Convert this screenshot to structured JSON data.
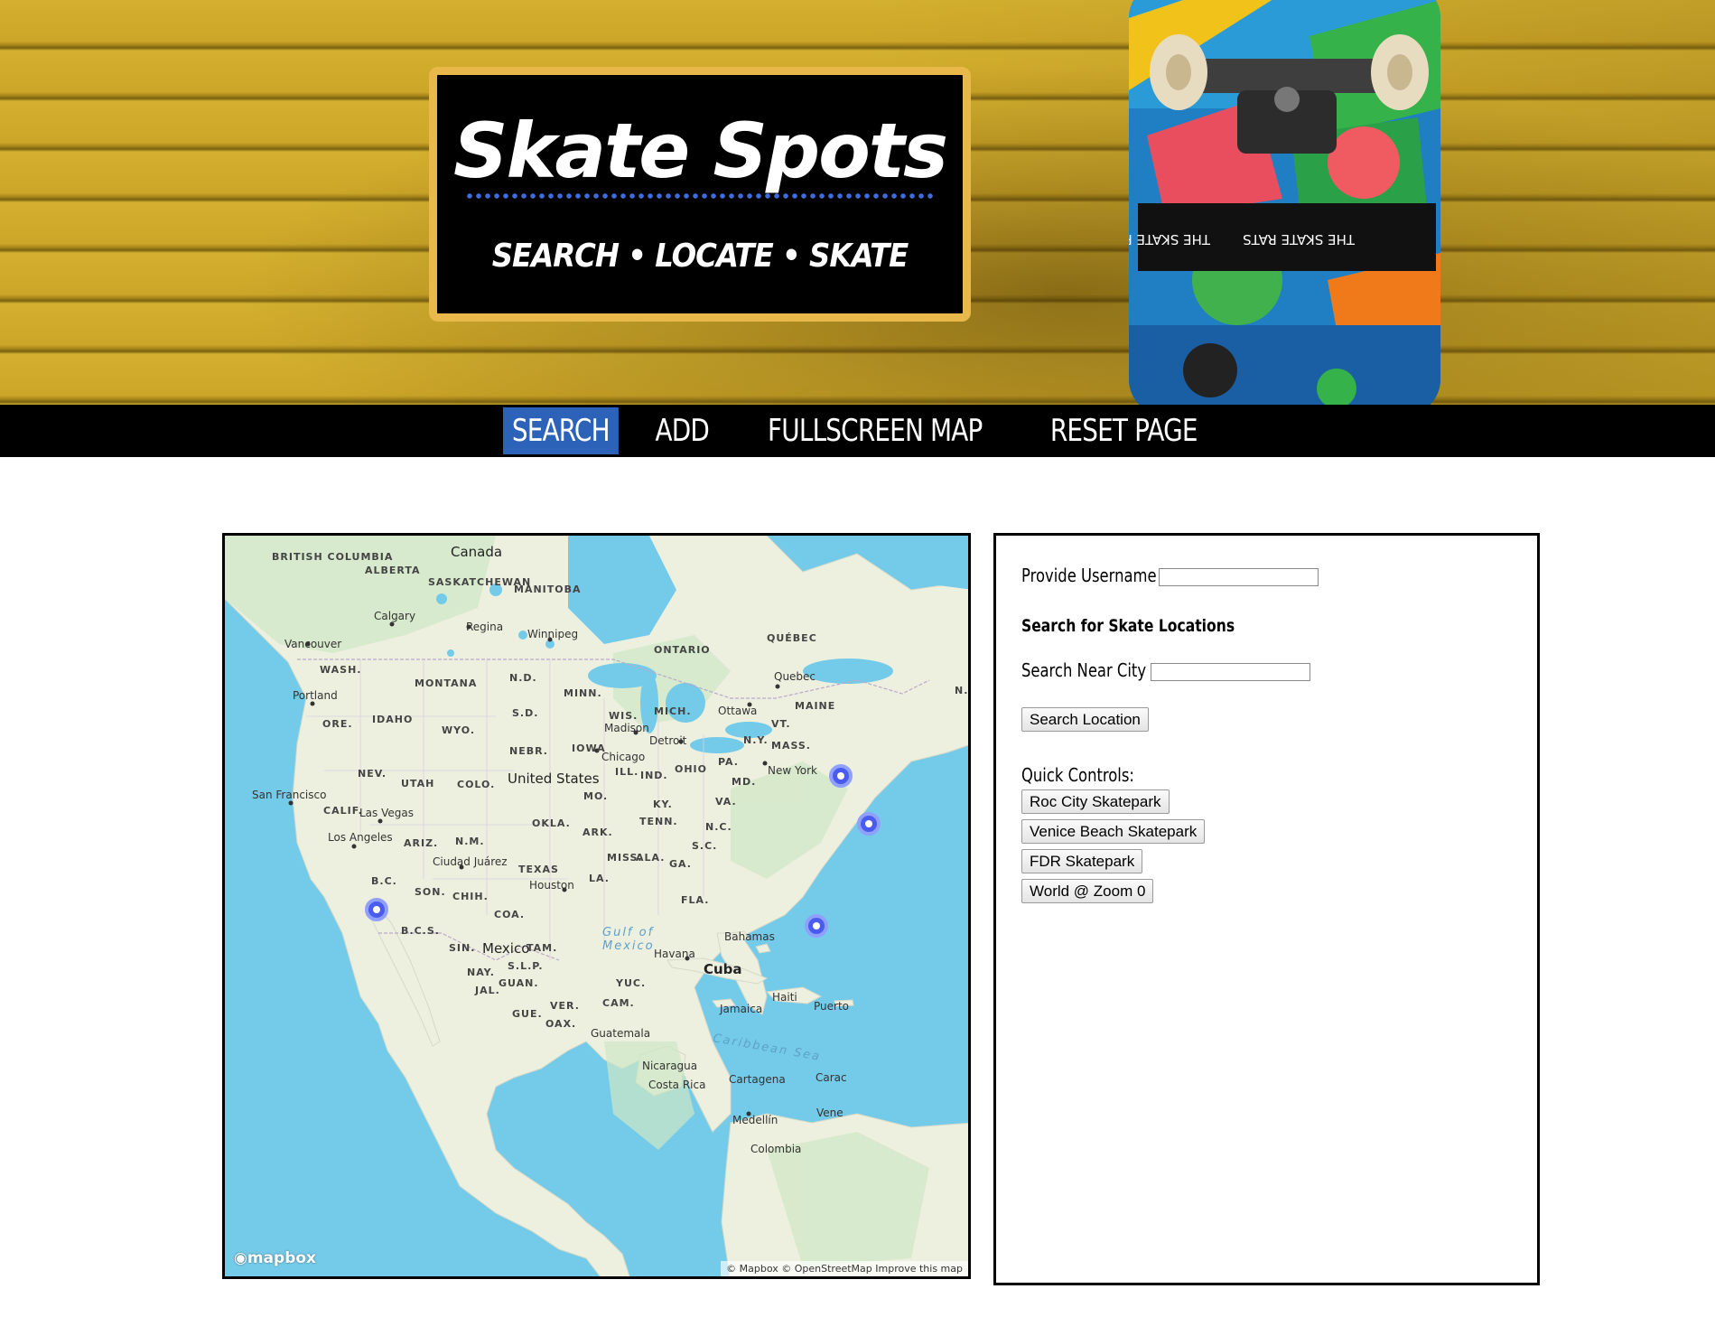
{
  "header": {
    "title": "Skate Spots",
    "tagline": "SEARCH • LOCATE • SKATE",
    "deck_brand": "THE SKATE RATS"
  },
  "nav": {
    "items": [
      {
        "label": "SEARCH",
        "active": true
      },
      {
        "label": "ADD",
        "active": false
      },
      {
        "label": "FULLSCREEN MAP",
        "active": false
      },
      {
        "label": "RESET PAGE",
        "active": false
      }
    ]
  },
  "map": {
    "countries": {
      "canada": "Canada",
      "us": "United States",
      "mexico": "Mexico",
      "cuba": "Cuba"
    },
    "provinces": {
      "bc": "BRITISH COLUMBIA",
      "ab": "ALBERTA",
      "sk": "SASKATCHEWAN",
      "mb": "MANITOBA",
      "on": "ONTARIO",
      "qc": "QUÉBEC"
    },
    "states": {
      "wa": "WASH.",
      "or": "ORE.",
      "id": "IDAHO",
      "mt": "MONTANA",
      "wy": "WYO.",
      "nd": "N.D.",
      "sd": "S.D.",
      "nebr": "NEBR.",
      "minn": "MINN.",
      "wis": "WIS.",
      "mich": "MICH.",
      "iowa": "IOWA",
      "ill": "ILL.",
      "ind": "IND.",
      "ohio": "OHIO",
      "pa": "PA.",
      "ny": "N.Y.",
      "mass": "MASS.",
      "vt": "VT.",
      "maine": "MAINE",
      "nev": "NEV.",
      "utah": "UTAH",
      "colo": "COLO.",
      "calif": "CALIF.",
      "ariz": "ARIZ.",
      "nm": "N.M.",
      "texas": "TEXAS",
      "okla": "OKLA.",
      "ark": "ARK.",
      "mo": "MO.",
      "ky": "KY.",
      "tenn": "TENN.",
      "va": "VA.",
      "md": "MD.",
      "nc": "N.C.",
      "sc": "S.C.",
      "miss": "MISS.",
      "ala": "ALA.",
      "ga": "GA.",
      "la": "LA.",
      "fla": "FLA.",
      "nb": "N.B"
    },
    "mx_states": {
      "bc": "B.C.",
      "son": "SON.",
      "chih": "CHIH.",
      "coa": "COA.",
      "bcs": "B.C.S.",
      "sin": "SIN.",
      "tam": "TAM.",
      "nay": "NAY.",
      "slp": "S.L.P.",
      "jal": "JAL.",
      "guan": "GUAN.",
      "gue": "GUE.",
      "oax": "OAX.",
      "ver": "VER.",
      "cam": "CAM.",
      "yuc": "YUC."
    },
    "cities": {
      "vancouver": "Vancouver",
      "calgary": "Calgary",
      "regina": "Regina",
      "winnipeg": "Winnipeg",
      "portland": "Portland",
      "quebec": "Quebec",
      "ottawa": "Ottawa",
      "madison": "Madison",
      "detroit": "Detroit",
      "chicago": "Chicago",
      "new_york": "New York",
      "san_francisco": "San Francisco",
      "las_vegas": "Las Vegas",
      "los_angeles": "Los Angeles",
      "ciudad_juarez": "Ciudad Juárez",
      "houston": "Houston",
      "havana": "Havana",
      "bahamas": "Bahamas",
      "jamaica": "Jamaica",
      "haiti": "Haiti",
      "puerto": "Puerto",
      "guatemala": "Guatemala",
      "nicaragua": "Nicaragua",
      "costa_rica": "Costa Rica",
      "cartagena": "Cartagena",
      "caracas": "Carac",
      "medellin": "Medellín",
      "colombia": "Colombia",
      "venezuela": "Vene"
    },
    "water": {
      "gulf1": "Gulf of",
      "gulf2": "Mexico",
      "caribbean": "Caribbean Sea"
    },
    "logo": "mapbox",
    "attribution": "© Mapbox © OpenStreetMap  Improve this map",
    "marker_color": "#4a5cf0"
  },
  "panel": {
    "username_label": "Provide Username :",
    "username_value": "",
    "search_heading": "Search for Skate Locations",
    "city_label": "Search Near City :",
    "city_value": "",
    "search_button": "Search Location",
    "quick_label": "Quick Controls:",
    "quick_buttons": [
      "Roc City Skatepark",
      "Venice Beach Skatepark",
      "FDR Skatepark",
      "World @ Zoom 0"
    ]
  }
}
